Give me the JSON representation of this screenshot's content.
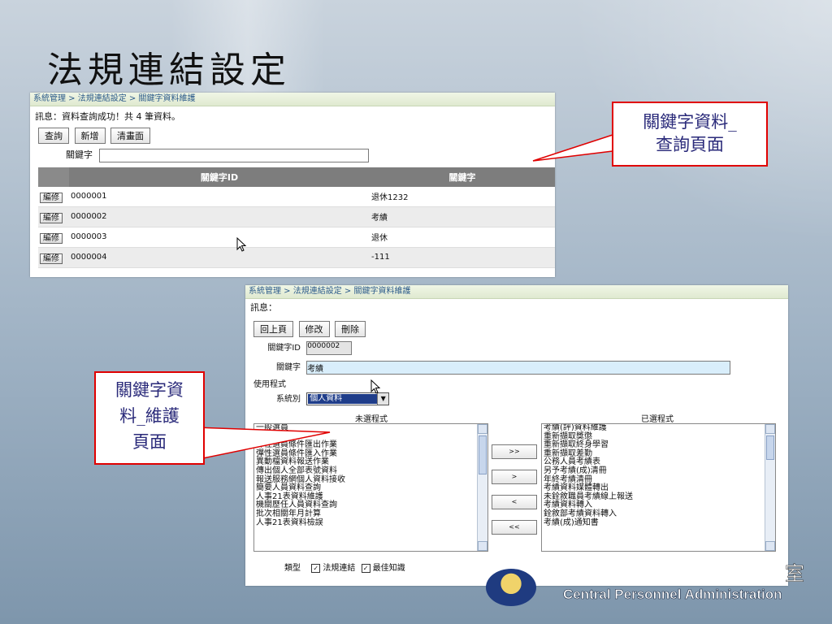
{
  "slide": {
    "title": "法規連結設定"
  },
  "query_page": {
    "breadcrumb": "系統管理 > 法規連結設定 > 關鍵字資料維護",
    "message": "訊息：資料查詢成功！共 4 筆資料。",
    "buttons": {
      "query": "查詢",
      "add": "新增",
      "clear": "清畫面"
    },
    "keyword_label": "關鍵字",
    "keyword_value": "",
    "table": {
      "headers": [
        "關鍵字ID",
        "關鍵字"
      ],
      "edit_label": "編修",
      "rows": [
        {
          "id": "0000001",
          "keyword": "退休1232"
        },
        {
          "id": "0000002",
          "keyword": "考績"
        },
        {
          "id": "0000003",
          "keyword": "退休"
        },
        {
          "id": "0000004",
          "keyword": "-111"
        }
      ]
    }
  },
  "maint_page": {
    "breadcrumb": "系統管理 > 法規連結設定 > 關鍵字資料維護",
    "message": "訊息：",
    "buttons": {
      "back": "回上頁",
      "modify": "修改",
      "delete": "刪除"
    },
    "id_label": "關鍵字ID",
    "id_value": "0000002",
    "keyword_label": "關鍵字",
    "keyword_value": "考績",
    "program_label": "使用程式",
    "system_label": "系統別",
    "system_value": "個人資料",
    "unselected_title": "未選程式",
    "selected_title": "已選程式",
    "unselected": [
      "一般選員",
      "彈性選員",
      "彈性選員條件匯出作業",
      "彈性選員條件匯入作業",
      "異動檔資料報送作業",
      "傳出個人全部表號資料",
      "報送服務網個人資料接收",
      "簡要人員資料查詢",
      "人事21表資料維護",
      "機關歷任人員資料查詢",
      "批次相關年月計算",
      "人事21表資料檢誤"
    ],
    "selected": [
      "考績(評)資料維護",
      "重新擷取獎懲",
      "重新擷取終身學習",
      "重新擷取差勤",
      "公務人員考績表",
      "另予考績(成)清冊",
      "年終考績清冊",
      "考績資料媒體轉出",
      "未銓敘職員考績線上報送",
      "考績資料轉入",
      "銓敘部考績資料轉入",
      "考績(成)通知書"
    ],
    "move_buttons": [
      ">>",
      ">",
      "<",
      "<<"
    ],
    "type_label": "類型",
    "type_options": [
      {
        "label": "法規連結",
        "checked": true
      },
      {
        "label": "最佳知識",
        "checked": true
      }
    ]
  },
  "callouts": {
    "query_line1": "關鍵字資料_",
    "query_line2": "查詢頁面",
    "maint_line1": "關鍵字資",
    "maint_line2": "料_維護",
    "maint_line3": "頁面"
  },
  "logo": {
    "text": "Central Personnel Administration",
    "char": "室"
  }
}
